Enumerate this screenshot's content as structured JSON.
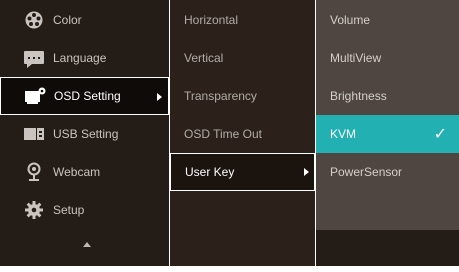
{
  "menu": {
    "main_items": [
      {
        "label": "Color",
        "icon": "color-palette-icon"
      },
      {
        "label": "Language",
        "icon": "language-keyboard-icon"
      },
      {
        "label": "OSD Setting",
        "icon": "osd-setting-icon"
      },
      {
        "label": "USB Setting",
        "icon": "usb-setting-icon"
      },
      {
        "label": "Webcam",
        "icon": "webcam-icon"
      },
      {
        "label": "Setup",
        "icon": "setup-gear-icon"
      }
    ],
    "selected_main": "OSD Setting",
    "sub_items": [
      {
        "label": "Horizontal"
      },
      {
        "label": "Vertical"
      },
      {
        "label": "Transparency"
      },
      {
        "label": "OSD Time Out"
      },
      {
        "label": "User Key"
      }
    ],
    "selected_sub": "User Key",
    "options": [
      {
        "label": "Volume"
      },
      {
        "label": "MultiView"
      },
      {
        "label": "Brightness"
      },
      {
        "label": "KVM"
      },
      {
        "label": "PowerSensor"
      }
    ],
    "selected_option": "KVM"
  },
  "colors": {
    "accent": "#23b0b3",
    "panel_main": "#241c16",
    "panel_sub": "#2b211a",
    "panel_options": "#4f4641"
  }
}
